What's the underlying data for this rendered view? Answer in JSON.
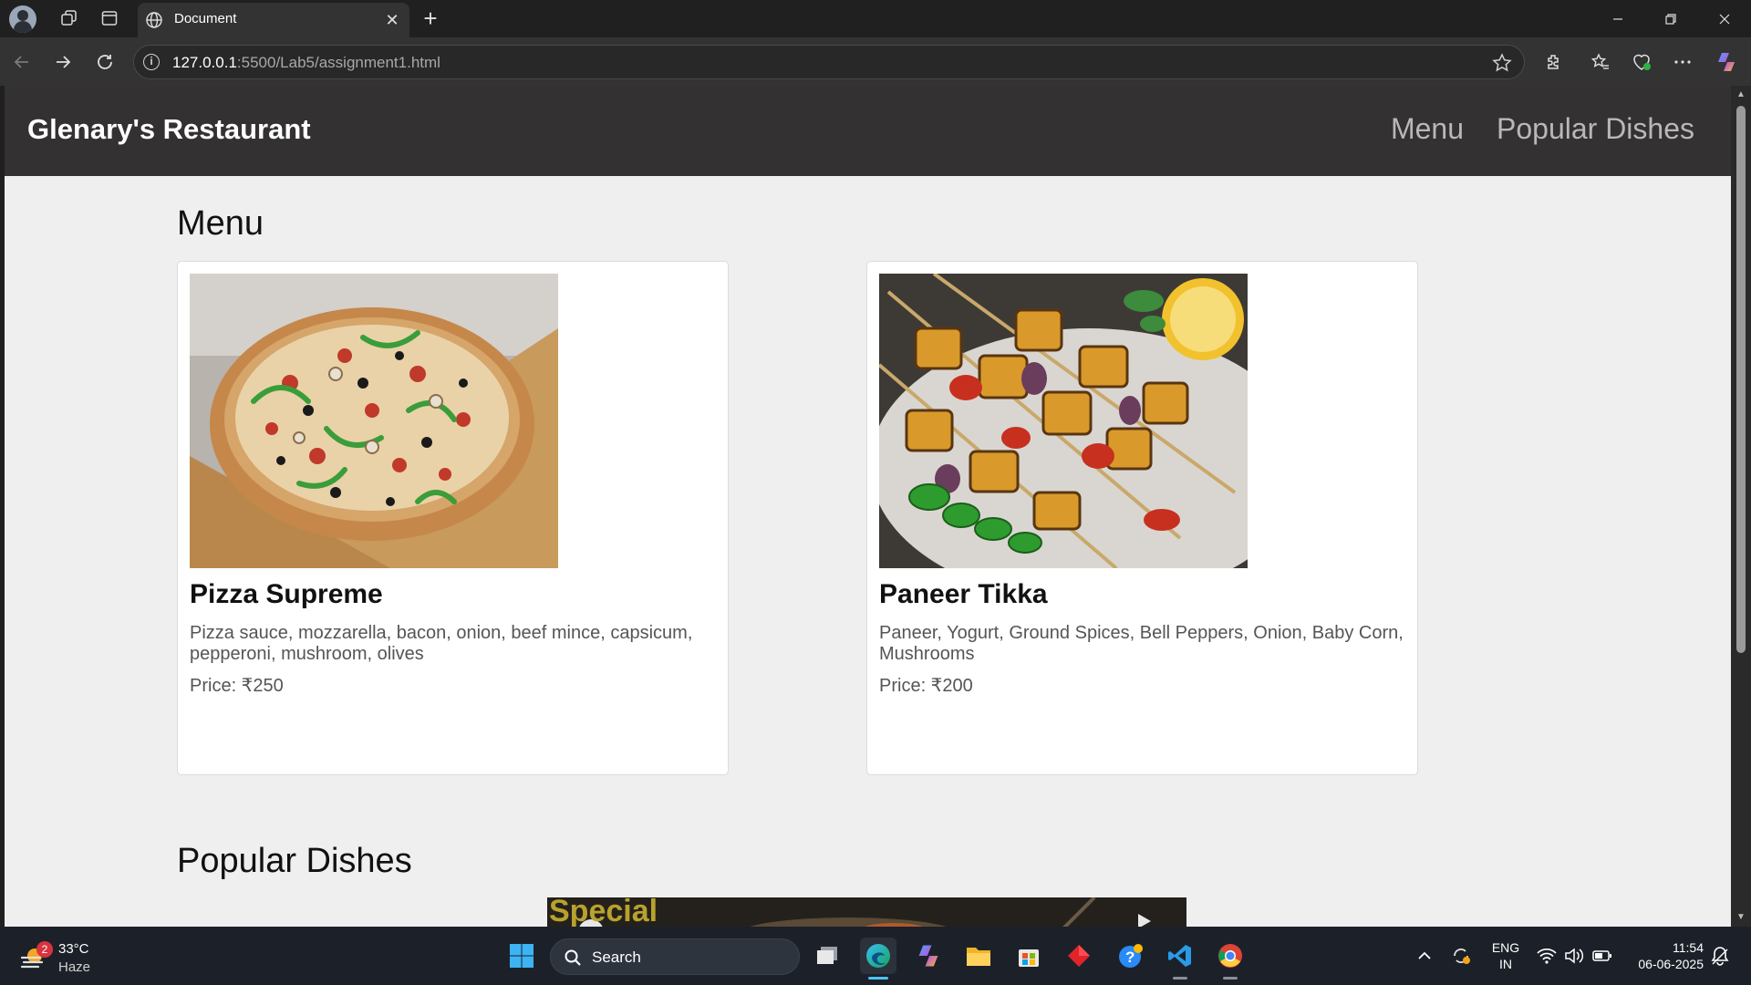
{
  "browser": {
    "tab_title": "Document",
    "url_host": "127.0.0.1",
    "url_rest": ":5500/Lab5/assignment1.html"
  },
  "site": {
    "brand": "Glenary's Restaurant",
    "nav": [
      "Menu",
      "Popular Dishes"
    ],
    "menu_heading": "Menu",
    "popular_heading": "Popular Dishes",
    "video_text": "Special",
    "items": [
      {
        "name": "Pizza Supreme",
        "description": "Pizza sauce, mozzarella, bacon, onion, beef mince, capsicum, pepperoni, mushroom, olives",
        "price": "Price: ₹250"
      },
      {
        "name": "Paneer Tikka",
        "description": "Paneer, Yogurt, Ground Spices, Bell Peppers, Onion, Baby Corn, Mushrooms",
        "price": "Price: ₹200"
      }
    ]
  },
  "taskbar": {
    "weather_temp": "33°C",
    "weather_condition": "Haze",
    "weather_badge": "2",
    "search_label": "Search",
    "lang_line1": "ENG",
    "lang_line2": "IN",
    "time": "11:54",
    "date": "06-06-2025"
  }
}
